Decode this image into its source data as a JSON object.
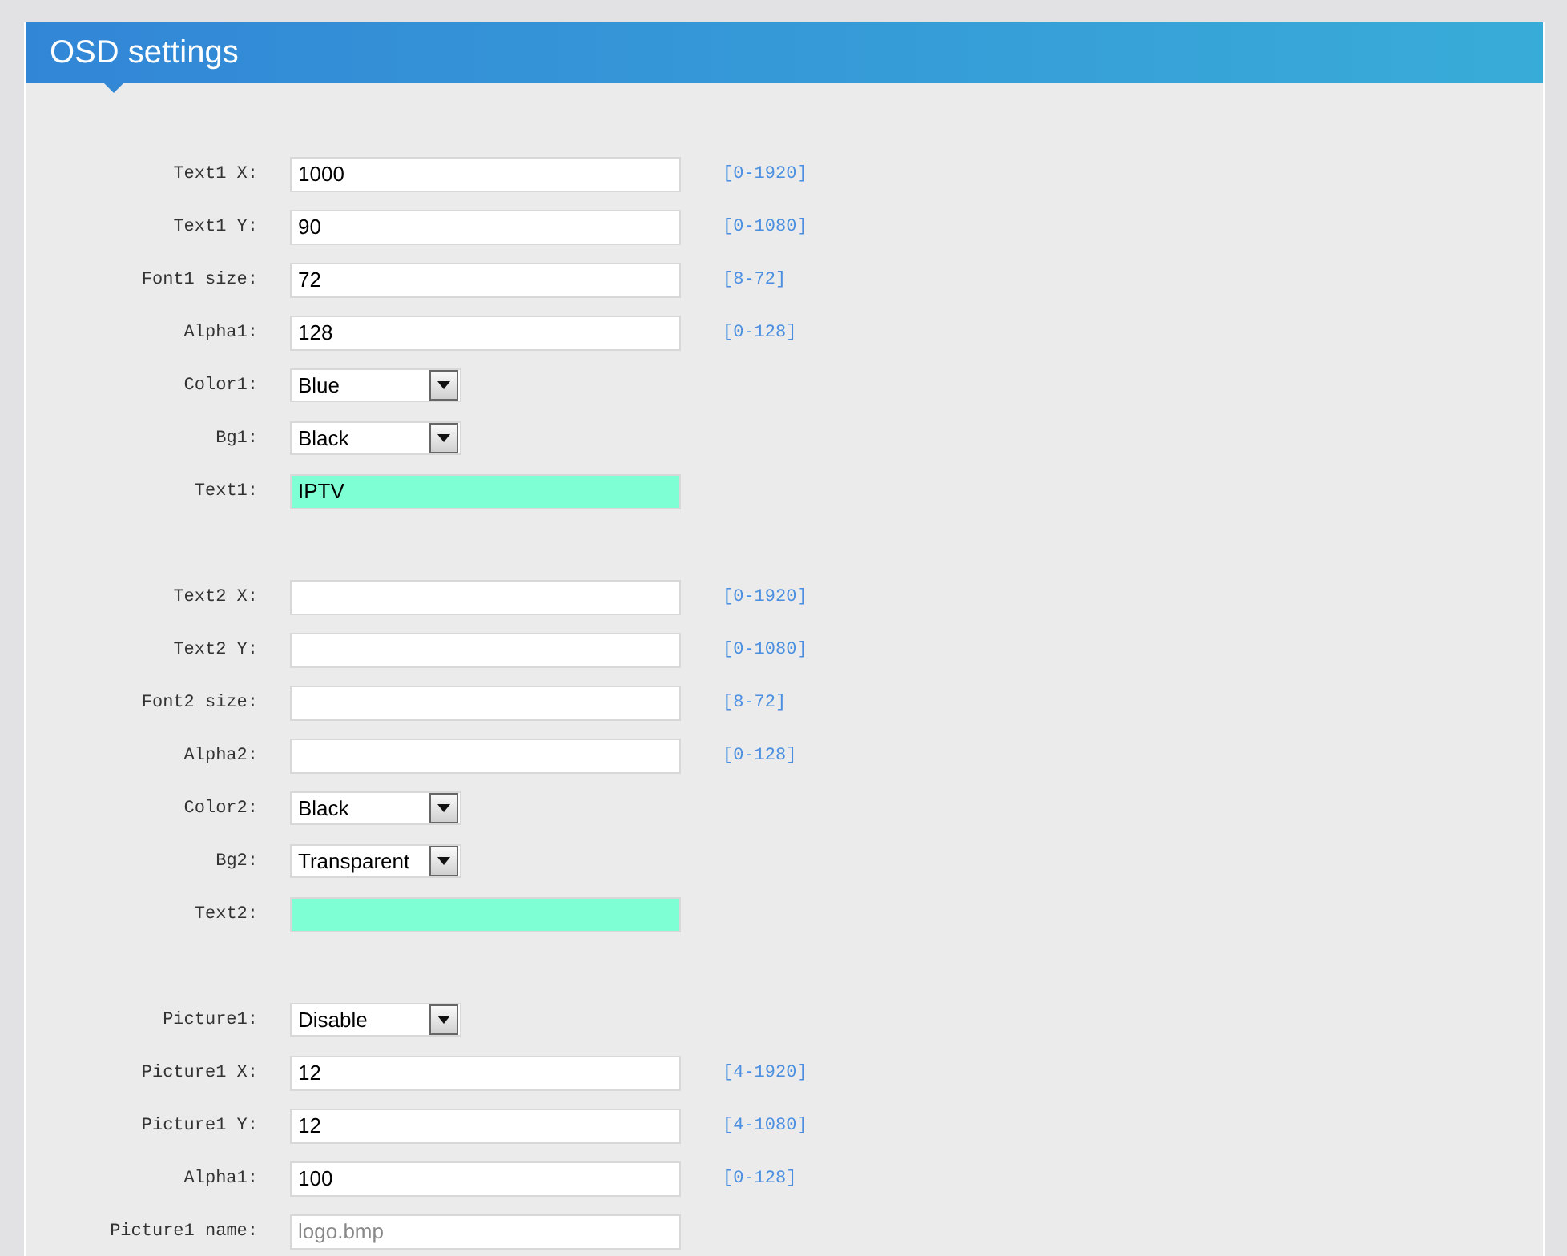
{
  "header": {
    "title": "OSD settings"
  },
  "groups": [
    {
      "rows": [
        {
          "kind": "input",
          "label": "Text1 X:",
          "value": "1000",
          "hint": "[0-1920]"
        },
        {
          "kind": "input",
          "label": "Text1 Y:",
          "value": "90",
          "hint": "[0-1080]"
        },
        {
          "kind": "input",
          "label": "Font1 size:",
          "value": "72",
          "hint": "[8-72]"
        },
        {
          "kind": "input",
          "label": "Alpha1:",
          "value": "128",
          "hint": "[0-128]"
        },
        {
          "kind": "select",
          "label": "Color1:",
          "value": "Blue"
        },
        {
          "kind": "select",
          "label": "Bg1:",
          "value": "Black"
        },
        {
          "kind": "text",
          "label": "Text1:",
          "value": "IPTV"
        }
      ]
    },
    {
      "rows": [
        {
          "kind": "input",
          "label": "Text2 X:",
          "hint": "[0-1920]"
        },
        {
          "kind": "input",
          "label": "Text2 Y:",
          "hint": "[0-1080]"
        },
        {
          "kind": "input",
          "label": "Font2 size:",
          "hint": "[8-72]"
        },
        {
          "kind": "input",
          "label": "Alpha2:",
          "hint": "[0-128]"
        },
        {
          "kind": "select",
          "label": "Color2:",
          "value": "Black"
        },
        {
          "kind": "select",
          "label": "Bg2:",
          "value": "Transparent"
        },
        {
          "kind": "text",
          "label": "Text2:"
        }
      ]
    },
    {
      "rows": [
        {
          "kind": "select",
          "label": "Picture1:",
          "value": "Disable"
        },
        {
          "kind": "input",
          "label": "Picture1 X:",
          "value": "12",
          "hint": "[4-1920]"
        },
        {
          "kind": "input",
          "label": "Picture1 Y:",
          "value": "12",
          "hint": "[4-1080]"
        },
        {
          "kind": "input",
          "label": "Alpha1:",
          "value": "100",
          "hint": "[0-128]"
        },
        {
          "kind": "input",
          "label": "Picture1 name:",
          "placeholder": "logo.bmp"
        }
      ]
    }
  ]
}
